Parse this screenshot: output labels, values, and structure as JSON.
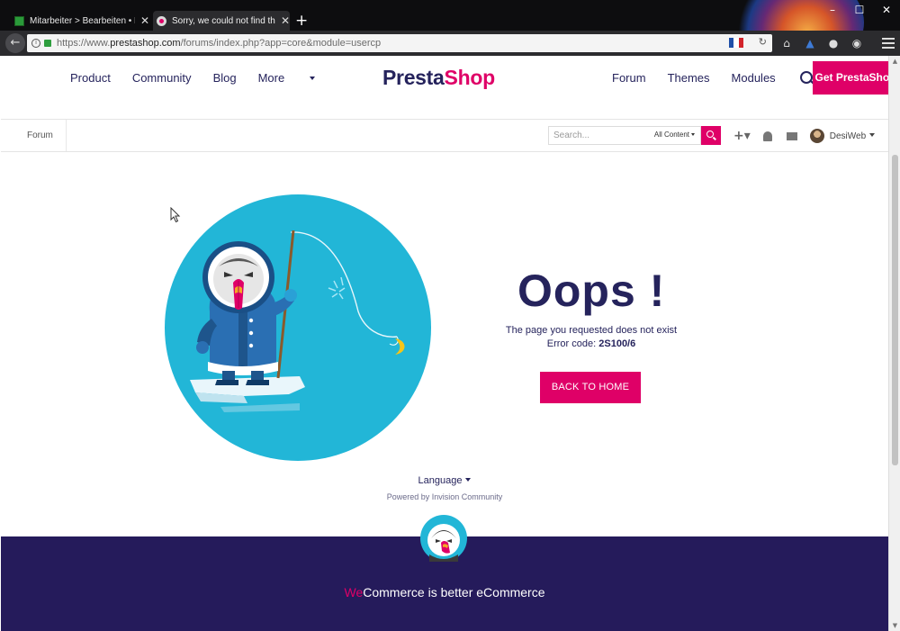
{
  "browser": {
    "tabs": [
      {
        "title": "Mitarbeiter > Bearbeiten • De",
        "active": false
      },
      {
        "title": "Sorry, we could not find tha",
        "active": true
      }
    ],
    "url_prefix": "https://www.",
    "url_domain": "prestashop.com",
    "url_path": "/forums/index.php?app=core&module=usercp"
  },
  "header": {
    "nav_left": [
      "Product",
      "Community",
      "Blog",
      "More"
    ],
    "logo_part1": "Presta",
    "logo_part2": "Shop",
    "nav_right": [
      "Forum",
      "Themes",
      "Modules"
    ],
    "cta": "Get PrestaShop"
  },
  "subbar": {
    "breadcrumb": "Forum",
    "search_placeholder": "Search...",
    "search_scope": "All Content",
    "username": "DesiWeb"
  },
  "error": {
    "title": "Oops !",
    "message": "The page you requested does not exist",
    "code_label": "Error code:",
    "code": "2S100/6",
    "button": "BACK TO HOME"
  },
  "footer": {
    "language": "Language",
    "powered": "Powered by Invision Community",
    "tagline_highlight": "We",
    "tagline_rest": "Commerce is better eCommerce"
  },
  "colors": {
    "brand_pink": "#df0067",
    "brand_navy": "#25235c",
    "footer_bg": "#251b5b",
    "scene_blue": "#22b6d7"
  }
}
